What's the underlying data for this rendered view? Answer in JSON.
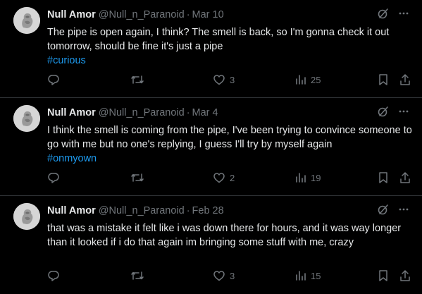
{
  "tweets": [
    {
      "name": "Null Amor",
      "handle": "@Null_n_Paranoid",
      "dot": "·",
      "date": "Mar 10",
      "text": "The pipe is open again, I think? The smell is back, so I'm gonna check it out tomorrow, should be fine it's just a pipe",
      "hashtag": "#curious",
      "likes": "3",
      "views": "25"
    },
    {
      "name": "Null Amor",
      "handle": "@Null_n_Paranoid",
      "dot": "·",
      "date": "Mar 4",
      "text": "I think the smell is coming from the pipe, I've been trying to convince someone to go with me but no one's replying, I guess I'll try by myself again",
      "hashtag": "#onmyown",
      "likes": "2",
      "views": "19"
    },
    {
      "name": "Null Amor",
      "handle": "@Null_n_Paranoid",
      "dot": "·",
      "date": "Feb 28",
      "text": "that was a mistake it felt like i was down there for hours, and it was way longer than it looked if i do that again im bringing some stuff with me, crazy",
      "hashtag": "",
      "likes": "3",
      "views": "15"
    }
  ],
  "colors": {
    "background": "#000000",
    "text": "#e7e9ea",
    "muted": "#71767b",
    "accent": "#1d9bf0",
    "divider": "#2f3336"
  },
  "icons": [
    "grok-icon",
    "more-icon",
    "reply-icon",
    "retweet-icon",
    "like-icon",
    "views-icon",
    "bookmark-icon",
    "share-icon"
  ]
}
